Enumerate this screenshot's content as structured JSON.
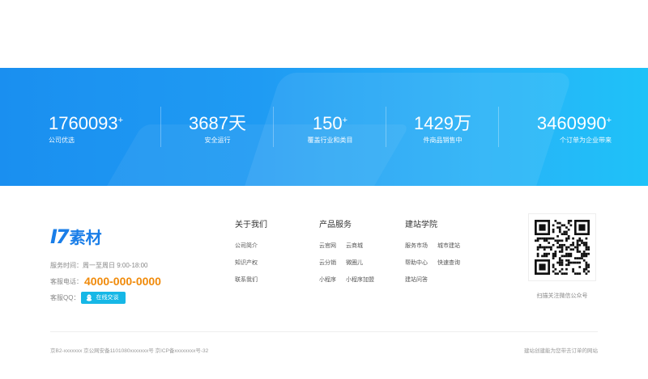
{
  "stats": [
    {
      "value": "1760093",
      "sup": "+",
      "label": "公司优选"
    },
    {
      "value": "3687天",
      "sup": "",
      "label": "安全运行"
    },
    {
      "value": "150",
      "sup": "+",
      "label": "覆盖行业和类目"
    },
    {
      "value": "1429万",
      "sup": "",
      "label": "件商品销售中"
    },
    {
      "value": "3460990",
      "sup": "+",
      "label": "个订单为企业带来"
    }
  ],
  "footer": {
    "logo": {
      "mark": "I7",
      "text": "素材"
    },
    "service_hours": "服务时间：周一至周日 9:00-18:00",
    "phone_label": "客服电话：",
    "phone": "4000-000-0000",
    "qq_label": "客服QQ：",
    "qq_button": "在线交谈",
    "columns": [
      {
        "title": "关于我们",
        "links": [
          "公司简介",
          "知识产权",
          "联系我们"
        ]
      },
      {
        "title": "产品服务",
        "links": [
          "云官网",
          "云商城",
          "云分销",
          "微圈儿",
          "小程序",
          "小程序加盟"
        ]
      },
      {
        "title": "建站学院",
        "links": [
          "服务市场",
          "城市建站",
          "帮助中心",
          "快速查询",
          "建站问答"
        ]
      }
    ],
    "qr_caption": "扫描关注微信公众号",
    "copyright": "京B2-xxxxxxx 京公网安备1101080xxxxxxx号 京ICP备xxxxxxxx号-32",
    "slogan": "建站创建能为您带去订单的网站"
  },
  "colors": {
    "accent": "#1a8ff0",
    "phone": "#f08a0a",
    "qq": "#16b7e6"
  }
}
